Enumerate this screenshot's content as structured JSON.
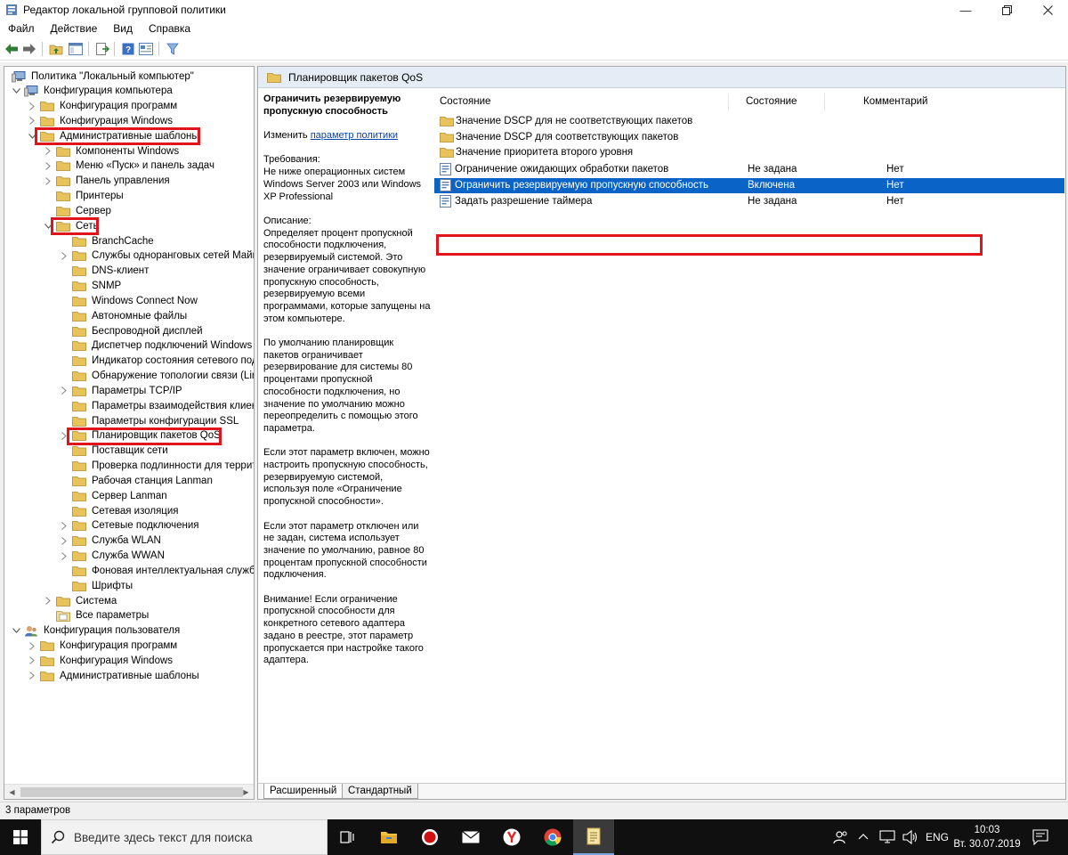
{
  "window": {
    "title": "Редактор локальной групповой политики"
  },
  "menu": [
    "Файл",
    "Действие",
    "Вид",
    "Справка"
  ],
  "tree": {
    "items": [
      {
        "label": "Политика \"Локальный компьютер\"",
        "level": 0,
        "chev": "none",
        "icon": "computer"
      },
      {
        "label": "Конфигурация компьютера",
        "level": 1,
        "chev": "open",
        "icon": "computer"
      },
      {
        "label": "Конфигурация программ",
        "level": 2,
        "chev": "closed",
        "icon": "folder"
      },
      {
        "label": "Конфигурация Windows",
        "level": 2,
        "chev": "closed",
        "icon": "folder"
      },
      {
        "label": "Административные шаблоны",
        "level": 2,
        "chev": "open",
        "icon": "folder"
      },
      {
        "label": "Компоненты Windows",
        "level": 3,
        "chev": "closed",
        "icon": "folder"
      },
      {
        "label": "Меню «Пуск» и панель задач",
        "level": 3,
        "chev": "closed",
        "icon": "folder"
      },
      {
        "label": "Панель управления",
        "level": 3,
        "chev": "closed",
        "icon": "folder"
      },
      {
        "label": "Принтеры",
        "level": 3,
        "chev": "none",
        "icon": "folder"
      },
      {
        "label": "Сервер",
        "level": 3,
        "chev": "none",
        "icon": "folder"
      },
      {
        "label": "Сеть",
        "level": 3,
        "chev": "open",
        "icon": "folder"
      },
      {
        "label": "BranchCache",
        "level": 4,
        "chev": "none",
        "icon": "folder"
      },
      {
        "label": "Службы одноранговых сетей Майкр",
        "level": 4,
        "chev": "closed",
        "icon": "folder"
      },
      {
        "label": "DNS-клиент",
        "level": 4,
        "chev": "none",
        "icon": "folder"
      },
      {
        "label": "SNMP",
        "level": 4,
        "chev": "none",
        "icon": "folder"
      },
      {
        "label": "Windows Connect Now",
        "level": 4,
        "chev": "none",
        "icon": "folder"
      },
      {
        "label": "Автономные файлы",
        "level": 4,
        "chev": "none",
        "icon": "folder"
      },
      {
        "label": "Беспроводной дисплей",
        "level": 4,
        "chev": "none",
        "icon": "folder"
      },
      {
        "label": "Диспетчер подключений Windows",
        "level": 4,
        "chev": "none",
        "icon": "folder"
      },
      {
        "label": "Индикатор состояния сетевого подк",
        "level": 4,
        "chev": "none",
        "icon": "folder"
      },
      {
        "label": "Обнаружение топологии связи (Link",
        "level": 4,
        "chev": "none",
        "icon": "folder"
      },
      {
        "label": "Параметры TCP/IP",
        "level": 4,
        "chev": "closed",
        "icon": "folder"
      },
      {
        "label": "Параметры взаимодействия клиент",
        "level": 4,
        "chev": "none",
        "icon": "folder"
      },
      {
        "label": "Параметры конфигурации SSL",
        "level": 4,
        "chev": "none",
        "icon": "folder"
      },
      {
        "label": "Планировщик пакетов QoS",
        "level": 4,
        "chev": "closed",
        "icon": "folder"
      },
      {
        "label": "Поставщик сети",
        "level": 4,
        "chev": "none",
        "icon": "folder"
      },
      {
        "label": "Проверка подлинности для террито",
        "level": 4,
        "chev": "none",
        "icon": "folder"
      },
      {
        "label": "Рабочая станция Lanman",
        "level": 4,
        "chev": "none",
        "icon": "folder"
      },
      {
        "label": "Сервер Lanman",
        "level": 4,
        "chev": "none",
        "icon": "folder"
      },
      {
        "label": "Сетевая изоляция",
        "level": 4,
        "chev": "none",
        "icon": "folder"
      },
      {
        "label": "Сетевые подключения",
        "level": 4,
        "chev": "closed",
        "icon": "folder"
      },
      {
        "label": "Служба WLAN",
        "level": 4,
        "chev": "closed",
        "icon": "folder"
      },
      {
        "label": "Служба WWAN",
        "level": 4,
        "chev": "closed",
        "icon": "folder"
      },
      {
        "label": "Фоновая интеллектуальная служба",
        "level": 4,
        "chev": "none",
        "icon": "folder"
      },
      {
        "label": "Шрифты",
        "level": 4,
        "chev": "none",
        "icon": "folder"
      },
      {
        "label": "Система",
        "level": 3,
        "chev": "closed",
        "icon": "folder"
      },
      {
        "label": "Все параметры",
        "level": 3,
        "chev": "none",
        "icon": "allsettings"
      },
      {
        "label": "Конфигурация пользователя",
        "level": 1,
        "chev": "open",
        "icon": "user"
      },
      {
        "label": "Конфигурация программ",
        "level": 2,
        "chev": "closed",
        "icon": "folder"
      },
      {
        "label": "Конфигурация Windows",
        "level": 2,
        "chev": "closed",
        "icon": "folder"
      },
      {
        "label": "Административные шаблоны",
        "level": 2,
        "chev": "closed",
        "icon": "folder"
      }
    ]
  },
  "right": {
    "header_title": "Планировщик пакетов QoS",
    "description": {
      "title": "Ограничить резервируемую пропускную способность",
      "edit_prefix": "Изменить",
      "edit_link": "параметр политики",
      "requirements": "Требования:\nНе ниже операционных систем Windows Server 2003 или Windows XP Professional",
      "paragraphs": [
        "Описание:\nОпределяет процент пропускной способности подключения, резервируемый системой. Это значение ограничивает совокупную пропускную способность, резервируемую всеми программами, которые запущены на этом компьютере.",
        "По умолчанию планировщик пакетов ограничивает резервирование для системы 80 процентами пропускной способности подключения, но значение по умолчанию можно переопределить с помощью этого параметра.",
        "Если этот параметр включен, можно настроить пропускную способность, резервируемую системой, используя поле «Ограничение пропускной способности».",
        "Если этот параметр отключен или не задан, система использует значение по умолчанию, равное 80 процентам пропускной способности подключения.",
        "Внимание! Если ограничение пропускной способности для конкретного сетевого адаптера задано в реестре, этот параметр пропускается при настройке такого адаптера."
      ]
    },
    "columns": [
      "Состояние",
      "Состояние",
      "Комментарий"
    ],
    "rows": [
      {
        "name": "Значение DSCP для не соответствующих пакетов",
        "state": "",
        "comment": "",
        "icon": "folder"
      },
      {
        "name": "Значение DSCP для соответствующих пакетов",
        "state": "",
        "comment": "",
        "icon": "folder"
      },
      {
        "name": "Значение приоритета второго уровня",
        "state": "",
        "comment": "",
        "icon": "folder"
      },
      {
        "name": "Ограничение ожидающих обработки пакетов",
        "state": "Не задана",
        "comment": "Нет",
        "icon": "policy"
      },
      {
        "name": "Ограничить резервируемую пропускную способность",
        "state": "Включена",
        "comment": "Нет",
        "icon": "policy"
      },
      {
        "name": "Задать разрешение таймера",
        "state": "Не задана",
        "comment": "Нет",
        "icon": "policy"
      }
    ],
    "tabs": [
      "Расширенный",
      "Стандартный"
    ]
  },
  "status": {
    "text": "3 параметров"
  },
  "taskbar": {
    "search_placeholder": "Введите здесь текст для поиска",
    "lang": "ENG",
    "time": "10:03",
    "date": "Вт. 30.07.2019"
  },
  "colors": {
    "selection": "#0a64c8",
    "highlight_box": "#e0141b",
    "folder": "#e8c25a"
  }
}
